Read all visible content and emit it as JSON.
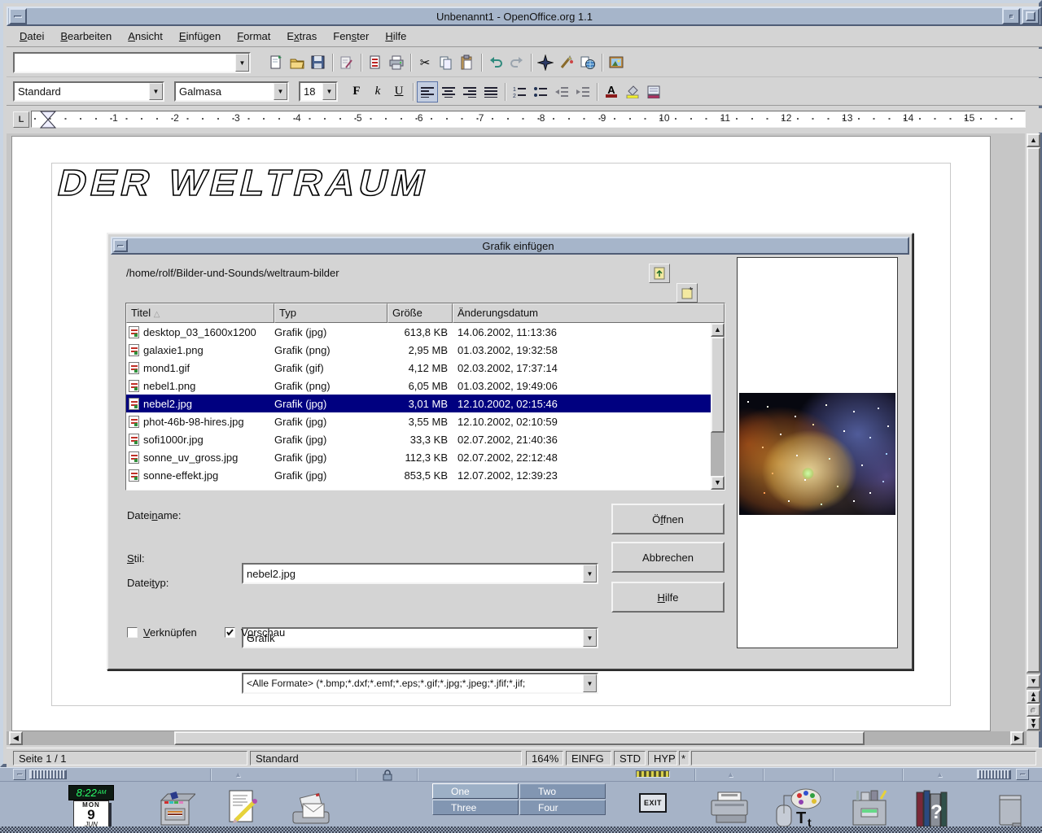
{
  "window": {
    "title": "Unbenannt1 - OpenOffice.org 1.1"
  },
  "menu": {
    "items": [
      {
        "label": "Datei",
        "ul": 0
      },
      {
        "label": "Bearbeiten",
        "ul": 0
      },
      {
        "label": "Ansicht",
        "ul": 0
      },
      {
        "label": "Einfügen",
        "ul": 0
      },
      {
        "label": "Format",
        "ul": 0
      },
      {
        "label": "Extras",
        "ul": 1
      },
      {
        "label": "Fenster",
        "ul": 3
      },
      {
        "label": "Hilfe",
        "ul": 0
      }
    ]
  },
  "toolbar": {
    "url_value": ""
  },
  "format_toolbar": {
    "style": "Standard",
    "font": "Galmasa",
    "size": "18",
    "bold": "F",
    "italic": "k",
    "underline": "U",
    "fontcolor": "A"
  },
  "ruler": {
    "numbers": [
      "1",
      "2",
      "3",
      "4",
      "5",
      "6",
      "7",
      "8",
      "9",
      "10",
      "11",
      "12",
      "13",
      "14",
      "15"
    ]
  },
  "document": {
    "heading": "DER WELTRAUM"
  },
  "dialog": {
    "title": "Grafik einfügen",
    "path": "/home/rolf/Bilder-und-Sounds/weltraum-bilder",
    "table": {
      "columns": [
        "Titel",
        "Typ",
        "Größe",
        "Änderungsdatum"
      ],
      "selected_index": 4,
      "rows": [
        {
          "name": "desktop_03_1600x1200",
          "type": "Grafik (jpg)",
          "size": "613,8 KB",
          "date": "14.06.2002, 11:13:36"
        },
        {
          "name": "galaxie1.png",
          "type": "Grafik (png)",
          "size": "2,95 MB",
          "date": "01.03.2002, 19:32:58"
        },
        {
          "name": "mond1.gif",
          "type": "Grafik (gif)",
          "size": "4,12 MB",
          "date": "02.03.2002, 17:37:14"
        },
        {
          "name": "nebel1.png",
          "type": "Grafik (png)",
          "size": "6,05 MB",
          "date": "01.03.2002, 19:49:06"
        },
        {
          "name": "nebel2.jpg",
          "type": "Grafik (jpg)",
          "size": "3,01 MB",
          "date": "12.10.2002, 02:15:46"
        },
        {
          "name": "phot-46b-98-hires.jpg",
          "type": "Grafik (jpg)",
          "size": "3,55 MB",
          "date": "12.10.2002, 02:10:59"
        },
        {
          "name": "sofi1000r.jpg",
          "type": "Grafik (jpg)",
          "size": "33,3 KB",
          "date": "02.07.2002, 21:40:36"
        },
        {
          "name": "sonne_uv_gross.jpg",
          "type": "Grafik (jpg)",
          "size": "112,3 KB",
          "date": "02.07.2002, 22:12:48"
        },
        {
          "name": "sonne-effekt.jpg",
          "type": "Grafik (jpg)",
          "size": "853,5 KB",
          "date": "12.07.2002, 12:39:23"
        }
      ]
    },
    "filename_label": "Dateiname:",
    "filename_value": "nebel2.jpg",
    "style_label": "Stil:",
    "style_value": "Grafik",
    "filetype_label": "Dateityp:",
    "filetype_value": "<Alle Formate> (*.bmp;*.dxf;*.emf;*.eps;*.gif;*.jpg;*.jpeg;*.jfif;*.jif;",
    "open_label": "Öffnen",
    "cancel_label": "Abbrechen",
    "help_label": "Hilfe",
    "link_label": "Verknüpfen",
    "preview_label": "Vorschau"
  },
  "statusbar": {
    "page": "Seite 1 / 1",
    "style": "Standard",
    "zoom": "164%",
    "insert_mode": "EINFG",
    "selection_mode": "STD",
    "hyperlink_mode": "HYP",
    "modified_flag": "*"
  },
  "panel": {
    "clock_time": "8:22",
    "clock_ampm": "AM",
    "calendar": {
      "weekday": "MON",
      "day": "9",
      "month": "JUN"
    },
    "workspaces": [
      {
        "label": "One"
      },
      {
        "label": "Two"
      },
      {
        "label": "Three"
      },
      {
        "label": "Four"
      }
    ],
    "active_workspace": 0,
    "exit_label": "EXIT"
  },
  "icons": {
    "sort_asc": "△",
    "combo_arrow": "▼",
    "scroll_up": "▲",
    "scroll_down": "▼",
    "scroll_left": "◀",
    "scroll_right": "▶",
    "subpanel_arrow": "▲",
    "cut_glyph": "✂"
  }
}
